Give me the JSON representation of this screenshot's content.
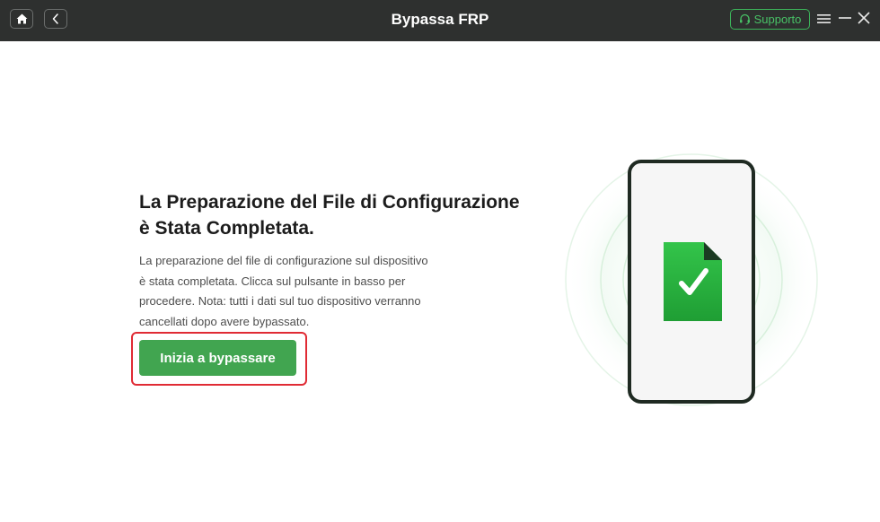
{
  "titlebar": {
    "title": "Bypassa FRP",
    "support_label": "Supporto",
    "icons": [
      "home-icon",
      "back-icon",
      "headset-icon",
      "menu-icon",
      "minimize-icon",
      "close-icon"
    ]
  },
  "main": {
    "heading_line1": "La Preparazione del File di Configurazione",
    "heading_line2": "è Stata Completata.",
    "description_lines": [
      "La preparazione del file di configurazione sul dispositivo",
      "è stata completata. Clicca sul pulsante in basso per",
      "procedere. Nota: tutti i dati sul tuo dispositivo verranno",
      "cancellati dopo avere bypassato."
    ],
    "start_button": "Inizia a bypassare"
  },
  "illustration": {
    "icons": [
      "phone-icon",
      "file-check-icon"
    ]
  },
  "colors": {
    "titlebar_bg": "#2e302f",
    "accent_green": "#41a550",
    "support_green": "#48c266",
    "highlight_red": "#e02b34"
  }
}
